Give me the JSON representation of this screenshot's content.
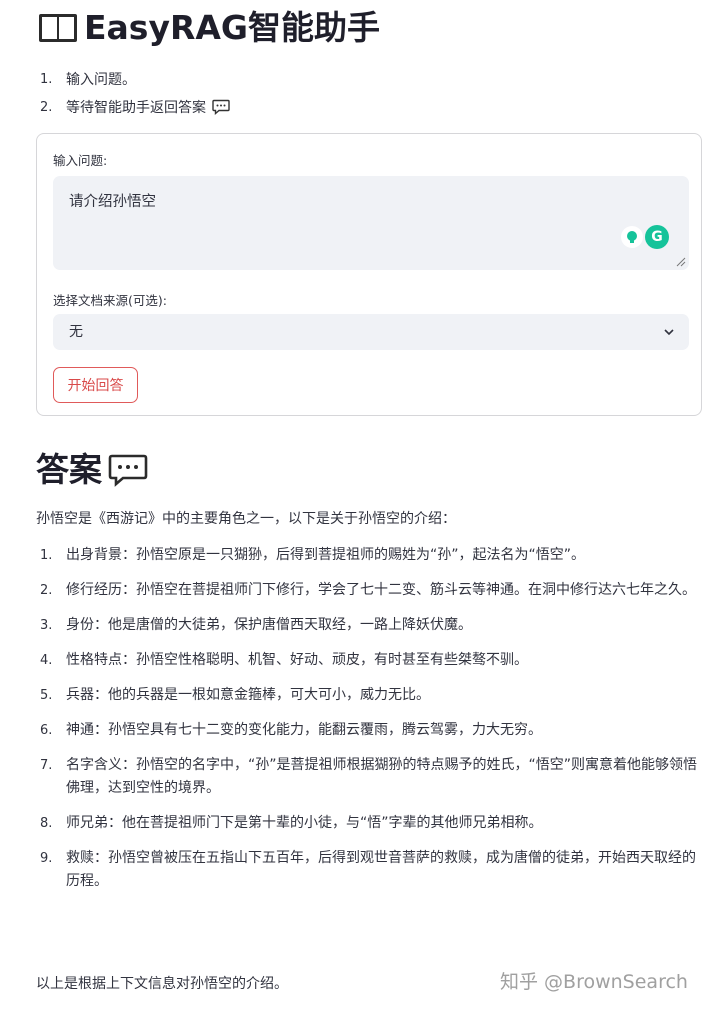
{
  "header": {
    "title": "EasyRAG智能助手",
    "icon": "book-icon"
  },
  "steps": [
    {
      "num": "1.",
      "text": "输入问题。"
    },
    {
      "num": "2.",
      "text": "等待智能助手返回答案"
    }
  ],
  "form": {
    "question_label": "输入问题:",
    "question_value": "请介绍孙悟空",
    "source_label": "选择文档来源(可选):",
    "source_value": "无",
    "submit_label": "开始回答"
  },
  "answer": {
    "heading": "答案",
    "intro": "孙悟空是《西游记》中的主要角色之一，以下是关于孙悟空的介绍：",
    "items": [
      {
        "num": "1.",
        "text": "出身背景：孙悟空原是一只猢狲，后得到菩提祖师的赐姓为“孙”，起法名为“悟空”。"
      },
      {
        "num": "2.",
        "text": "修行经历：孙悟空在菩提祖师门下修行，学会了七十二变、筋斗云等神通。在洞中修行达六七年之久。"
      },
      {
        "num": "3.",
        "text": "身份：他是唐僧的大徒弟，保护唐僧西天取经，一路上降妖伏魔。"
      },
      {
        "num": "4.",
        "text": "性格特点：孙悟空性格聪明、机智、好动、顽皮，有时甚至有些桀骜不驯。"
      },
      {
        "num": "5.",
        "text": "兵器：他的兵器是一根如意金箍棒，可大可小，威力无比。"
      },
      {
        "num": "6.",
        "text": "神通：孙悟空具有七十二变的变化能力，能翻云覆雨，腾云驾雾，力大无穷。"
      },
      {
        "num": "7.",
        "text": "名字含义：孙悟空的名字中，“孙”是菩提祖师根据猢狲的特点赐予的姓氏，“悟空”则寓意着他能够领悟佛理，达到空性的境界。"
      },
      {
        "num": "8.",
        "text": "师兄弟：他在菩提祖师门下是第十辈的小徒，与“悟”字辈的其他师兄弟相称。"
      },
      {
        "num": "9.",
        "text": "救赎：孙悟空曾被压在五指山下五百年，后得到观世音菩萨的救赎，成为唐僧的徒弟，开始西天取经的历程。"
      }
    ],
    "outro": "以上是根据上下文信息对孙悟空的介绍。"
  },
  "watermark": "知乎 @BrownSearch",
  "colors": {
    "accent": "#e05a5a",
    "input_bg": "#f0f2f6",
    "grammarly": "#15c39a"
  }
}
